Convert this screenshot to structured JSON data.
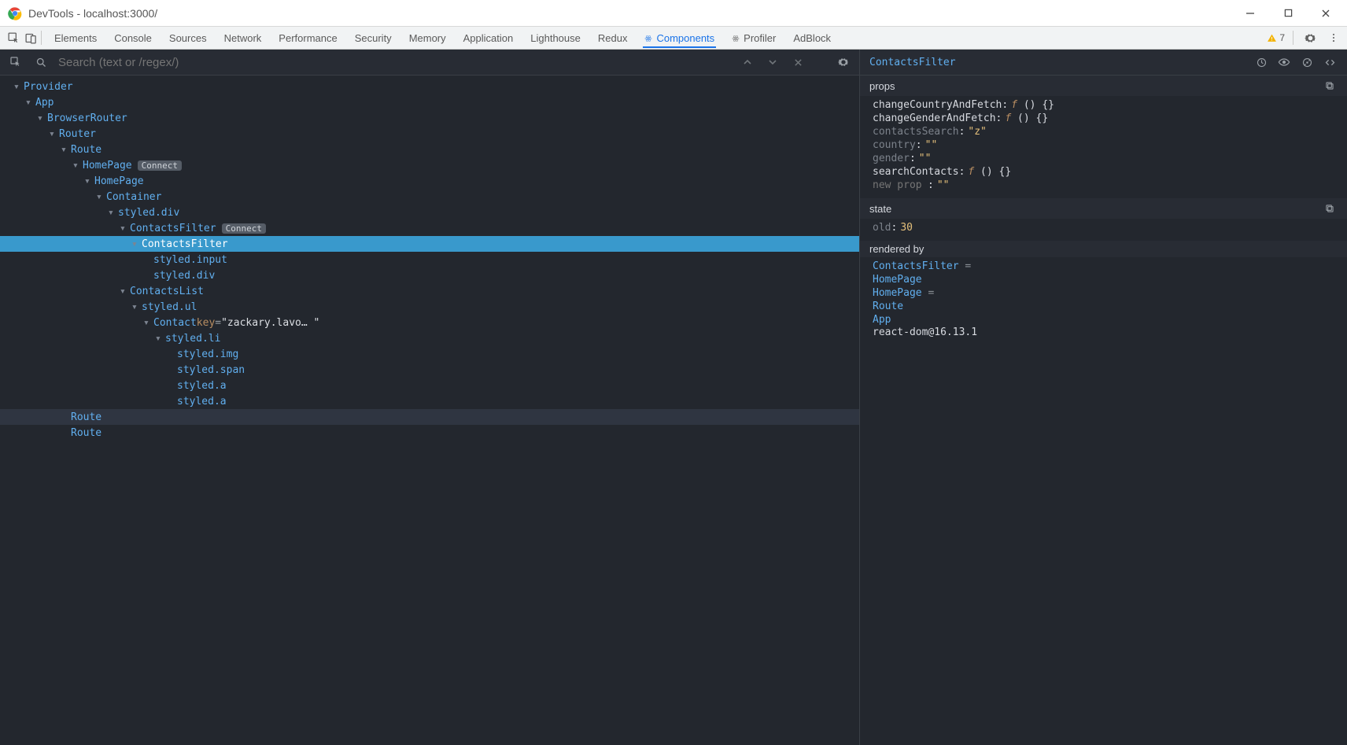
{
  "window": {
    "title": "DevTools - localhost:3000/"
  },
  "tabs": {
    "list": [
      "Elements",
      "Console",
      "Sources",
      "Network",
      "Performance",
      "Security",
      "Memory",
      "Application",
      "Lighthouse",
      "Redux",
      "Components",
      "Profiler",
      "AdBlock"
    ],
    "active": "Components"
  },
  "warning_count": "7",
  "search": {
    "placeholder": "Search (text or /regex/)"
  },
  "tree": [
    {
      "d": 1,
      "name": "Provider",
      "c": true
    },
    {
      "d": 2,
      "name": "App",
      "c": true
    },
    {
      "d": 3,
      "name": "BrowserRouter",
      "c": true
    },
    {
      "d": 4,
      "name": "Router",
      "c": true
    },
    {
      "d": 5,
      "name": "Route",
      "c": true
    },
    {
      "d": 6,
      "name": "HomePage",
      "c": true,
      "badge": "Connect"
    },
    {
      "d": 7,
      "name": "HomePage",
      "c": true
    },
    {
      "d": 8,
      "name": "Container",
      "c": true
    },
    {
      "d": 9,
      "name": "styled.div",
      "c": true
    },
    {
      "d": 10,
      "name": "ContactsFilter",
      "c": true,
      "badge": "Connect"
    },
    {
      "d": 11,
      "name": "ContactsFilter",
      "c": true,
      "sel": true
    },
    {
      "d": 12,
      "name": "styled.input"
    },
    {
      "d": 12,
      "name": "styled.div"
    },
    {
      "d": 10,
      "name": "ContactsList",
      "c": true
    },
    {
      "d": 11,
      "name": "styled.ul",
      "c": true
    },
    {
      "d": 12,
      "name": "Contact",
      "c": true,
      "attr_k": "key",
      "attr_v": "\"zackary.lavo… \""
    },
    {
      "d": 13,
      "name": "styled.li",
      "c": true
    },
    {
      "d": 14,
      "name": "styled.img"
    },
    {
      "d": 14,
      "name": "styled.span"
    },
    {
      "d": 14,
      "name": "styled.a"
    },
    {
      "d": 14,
      "name": "styled.a"
    },
    {
      "d": 5,
      "name": "Route",
      "hov": true
    },
    {
      "d": 5,
      "name": "Route"
    }
  ],
  "inspector": {
    "selected": "ContactsFilter",
    "props": [
      {
        "k": "changeCountryAndFetch",
        "type": "fn"
      },
      {
        "k": "changeGenderAndFetch",
        "type": "fn"
      },
      {
        "k": "contactsSearch",
        "type": "str",
        "v": "\"z\"",
        "muted": true
      },
      {
        "k": "country",
        "type": "str",
        "v": "\"\"",
        "muted": true
      },
      {
        "k": "gender",
        "type": "str",
        "v": "\"\"",
        "muted": true
      },
      {
        "k": "searchContacts",
        "type": "fn"
      }
    ],
    "new_prop_placeholder": "new prop",
    "new_prop_value": "\"\"",
    "state": [
      {
        "k": "old",
        "type": "num",
        "v": "30",
        "muted": true
      }
    ],
    "rendered_by": [
      {
        "label": "ContactsFilter",
        "suffix": " ="
      },
      {
        "label": "HomePage"
      },
      {
        "label": "HomePage",
        "suffix": " ="
      },
      {
        "label": "Route"
      },
      {
        "label": "App"
      }
    ],
    "renderer": "react-dom@16.13.1"
  },
  "labels": {
    "props": "props",
    "state": "state",
    "rendered_by": "rendered by"
  }
}
